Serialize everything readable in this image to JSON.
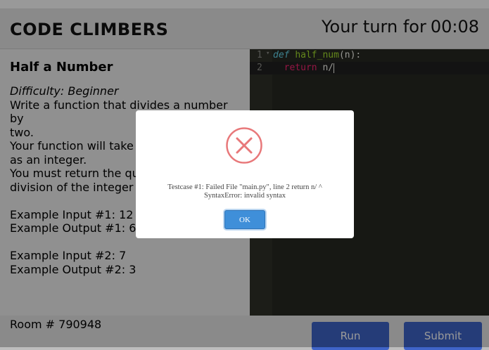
{
  "header": {
    "brand": "CODE CLIMBERS",
    "turn_label": "Your turn for",
    "time": "00:08"
  },
  "problem": {
    "title": "Half a Number",
    "difficulty": "Difficulty: Beginner",
    "description": [
      "Write a function that divides a number by",
      "two.",
      "Your function will take a",
      "as an integer.",
      "You must return the quo",
      "division of the integer"
    ],
    "examples": [
      {
        "input": "Example Input #1: 12",
        "output": "Example Output #1: 6"
      },
      {
        "input": "Example Input #2: 7",
        "output": "Example Output #2: 3"
      }
    ]
  },
  "editor": {
    "lines": [
      {
        "num": "1",
        "parts": [
          "def",
          " ",
          "half_num",
          "(n):"
        ]
      },
      {
        "num": "2",
        "parts": [
          "  ",
          "return",
          " n/"
        ]
      }
    ]
  },
  "footer": {
    "room": "Room # 790948",
    "run_label": "Run",
    "submit_label": "Submit"
  },
  "modal": {
    "icon": "error-x-icon",
    "message_line1": "Testcase #1: Failed File \"main.py\", line 2 return n/ ^",
    "message_line2": "SyntaxError: invalid syntax",
    "ok_label": "OK"
  }
}
